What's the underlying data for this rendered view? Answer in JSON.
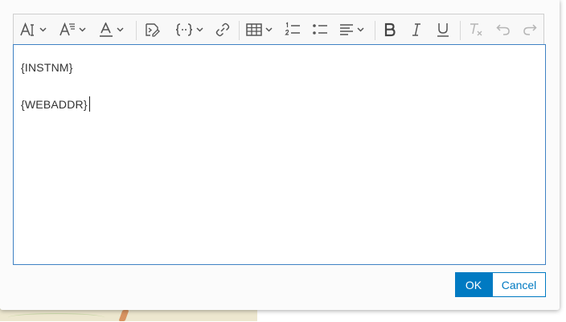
{
  "editor": {
    "lines": [
      "{INSTNM}",
      "{WEBADDR}"
    ]
  },
  "toolbar": {
    "groups": [
      [
        "font-size-icon",
        "text-style-icon",
        "font-color-icon"
      ],
      [
        "insert-expression-icon",
        "field-braces-icon",
        "link-icon"
      ],
      [
        "table-icon",
        "numbered-list-icon",
        "bulleted-list-icon",
        "align-icon"
      ],
      [
        "bold-icon",
        "italic-icon",
        "underline-icon"
      ],
      [
        "clear-formatting-icon",
        "undo-icon",
        "redo-icon"
      ]
    ]
  },
  "buttons": {
    "ok_label": "OK",
    "cancel_label": "Cancel"
  },
  "colors": {
    "accent": "#007ac2",
    "editor_border": "#3f82c4",
    "icon": "#555555",
    "icon_disabled": "#b5b5b5"
  }
}
